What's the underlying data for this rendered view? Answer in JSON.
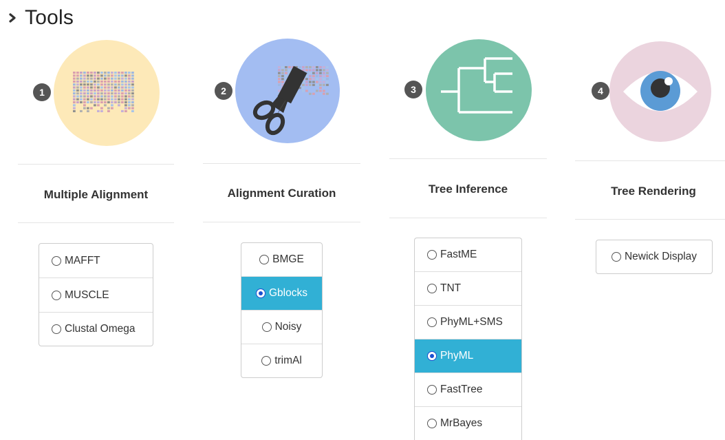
{
  "header": {
    "title": "Tools"
  },
  "steps": [
    {
      "number": "1",
      "title": "Multiple Alignment",
      "options": [
        {
          "label": "MAFFT",
          "selected": false
        },
        {
          "label": "MUSCLE",
          "selected": false
        },
        {
          "label": "Clustal Omega",
          "selected": false
        }
      ],
      "icon": "alignment-matrix-icon",
      "circle_color": "#fde9b8"
    },
    {
      "number": "2",
      "title": "Alignment Curation",
      "options": [
        {
          "label": "BMGE",
          "selected": false
        },
        {
          "label": "Gblocks",
          "selected": true
        },
        {
          "label": "Noisy",
          "selected": false
        },
        {
          "label": "trimAl",
          "selected": false
        }
      ],
      "icon": "scissors-icon",
      "circle_color": "#a3bdf2"
    },
    {
      "number": "3",
      "title": "Tree Inference",
      "options": [
        {
          "label": "FastME",
          "selected": false
        },
        {
          "label": "TNT",
          "selected": false
        },
        {
          "label": "PhyML+SMS",
          "selected": false
        },
        {
          "label": "PhyML",
          "selected": true
        },
        {
          "label": "FastTree",
          "selected": false
        },
        {
          "label": "MrBayes",
          "selected": false
        }
      ],
      "icon": "phylogenetic-tree-icon",
      "circle_color": "#7cc4ab"
    },
    {
      "number": "4",
      "title": "Tree Rendering",
      "options": [
        {
          "label": "Newick Display",
          "selected": false
        }
      ],
      "icon": "eye-icon",
      "circle_color": "#ebd4de"
    }
  ],
  "colors": {
    "selected_bg": "#31b0d5",
    "badge_bg": "#555555"
  }
}
